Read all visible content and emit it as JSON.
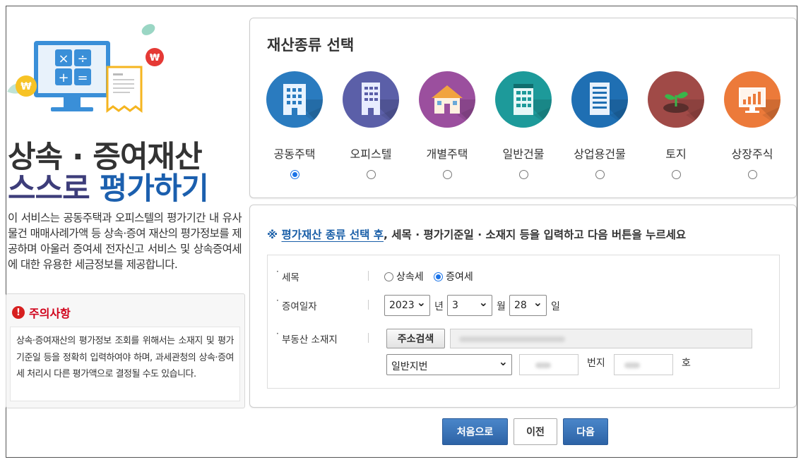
{
  "left": {
    "title_line1": "상속 · 증여재산",
    "title_line2a": "스스로",
    "title_line2b": "평가하기",
    "description": "이 서비스는 공동주택과 오피스텔의 평가기간 내 유사물건 매매사례가액 등 상속·증여 재산의 평가정보를 제공하며 아울러 증여세 전자신고 서비스 및 상속증여세에 대한 유용한 세금정보를 제공합니다.",
    "caution_title": "주의사항",
    "caution_body": "상속·증여재산의 평가정보 조회를 위해서는 소재지 및 평가기준일 등을 정확히 입력하여야 하며, 과세관청의 상속·증여세 처리시 다른 평가액으로 결정될 수도 있습니다."
  },
  "asset_panel": {
    "title": "재산종류 선택",
    "assets": [
      {
        "label": "공동주택",
        "icon": "apartment-icon",
        "color": "#2a7bbf",
        "selected": true
      },
      {
        "label": "오피스텔",
        "icon": "officetel-icon",
        "color": "#5b5fa8",
        "selected": false
      },
      {
        "label": "개별주택",
        "icon": "house-icon",
        "color": "#9b4f9e",
        "selected": false
      },
      {
        "label": "일반건물",
        "icon": "building-icon",
        "color": "#1d9a9a",
        "selected": false
      },
      {
        "label": "상업용건물",
        "icon": "commercial-building-icon",
        "color": "#1f6fb3",
        "selected": false
      },
      {
        "label": "토지",
        "icon": "land-sprout-icon",
        "color": "#a04a47",
        "selected": false
      },
      {
        "label": "상장주식",
        "icon": "stock-chart-icon",
        "color": "#ec7a3a",
        "selected": false
      }
    ]
  },
  "form": {
    "notice_mark": "※",
    "notice_highlight": "평가재산 종류 선택 후",
    "notice_rest": ", 세목 · 평가기준일 · 소재지 등을 입력하고 다음 버튼을 누르세요",
    "tax_label": "세목",
    "tax_options": [
      {
        "label": "상속세",
        "selected": false
      },
      {
        "label": "증여세",
        "selected": true
      }
    ],
    "date_label": "증여일자",
    "year": "2023",
    "year_unit": "년",
    "month": "3",
    "month_unit": "월",
    "day": "28",
    "day_unit": "일",
    "address_label": "부동산 소재지",
    "address_button": "주소검색",
    "lot_type": "일반지번",
    "lot_unit": "번지",
    "unit_suffix": "호"
  },
  "buttons": {
    "first": "처음으로",
    "prev": "이전",
    "next": "다음"
  }
}
